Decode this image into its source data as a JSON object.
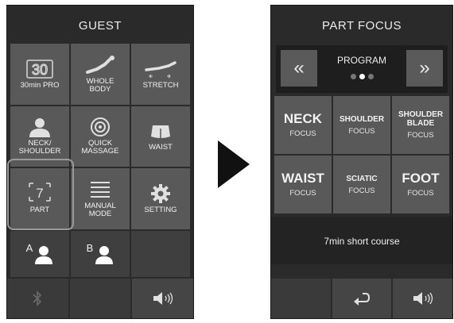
{
  "left_screen": {
    "title": "GUEST",
    "menu": [
      {
        "label": "30min PRO",
        "icon": "30min-icon",
        "selected": false
      },
      {
        "label": "WHOLE\nBODY",
        "icon": "whole-body-icon",
        "selected": false
      },
      {
        "label": "STRETCH",
        "icon": "stretch-icon",
        "selected": false
      },
      {
        "label": "NECK/\nSHOULDER",
        "icon": "neck-shoulder-icon",
        "selected": false
      },
      {
        "label": "QUICK\nMASSAGE",
        "icon": "quick-massage-icon",
        "selected": false
      },
      {
        "label": "WAIST",
        "icon": "waist-icon",
        "selected": false
      },
      {
        "label": "PART",
        "icon": "part-icon",
        "selected": true
      },
      {
        "label": "MANUAL\nMODE",
        "icon": "manual-mode-icon",
        "selected": false
      },
      {
        "label": "SETTING",
        "icon": "gear-icon",
        "selected": false
      }
    ],
    "users": [
      {
        "letter": "A",
        "icon": "user-icon"
      },
      {
        "letter": "B",
        "icon": "user-icon"
      }
    ],
    "part_icon_text": "7",
    "toolbar": [
      {
        "icon": "bluetooth-icon"
      },
      {
        "icon": ""
      },
      {
        "icon": "volume-icon"
      }
    ]
  },
  "right_screen": {
    "title": "PART FOCUS",
    "program": {
      "label": "PROGRAM",
      "prev_symbol": "«",
      "next_symbol": "»",
      "page_dots": 3,
      "active_dot": 2
    },
    "focus_items": [
      {
        "name": "NECK",
        "sub": "FOCUS",
        "size": "big"
      },
      {
        "name": "SHOULDER",
        "sub": "FOCUS",
        "size": "mid"
      },
      {
        "name": "SHOULDER\nBLADE",
        "sub": "FOCUS",
        "size": "mid"
      },
      {
        "name": "WAIST",
        "sub": "FOCUS",
        "size": "big"
      },
      {
        "name": "SCIATIC",
        "sub": "FOCUS",
        "size": "mid"
      },
      {
        "name": "FOOT",
        "sub": "FOCUS",
        "size": "big"
      }
    ],
    "short_course": "7min short course",
    "toolbar": [
      {
        "icon": ""
      },
      {
        "icon": "return-icon"
      },
      {
        "icon": "volume-icon"
      }
    ]
  },
  "colors": {
    "panel_bg": "#2a2a2a",
    "button_bg": "#595959",
    "selection_outline": "#9a9a9a",
    "text": "#f2f2f2"
  }
}
